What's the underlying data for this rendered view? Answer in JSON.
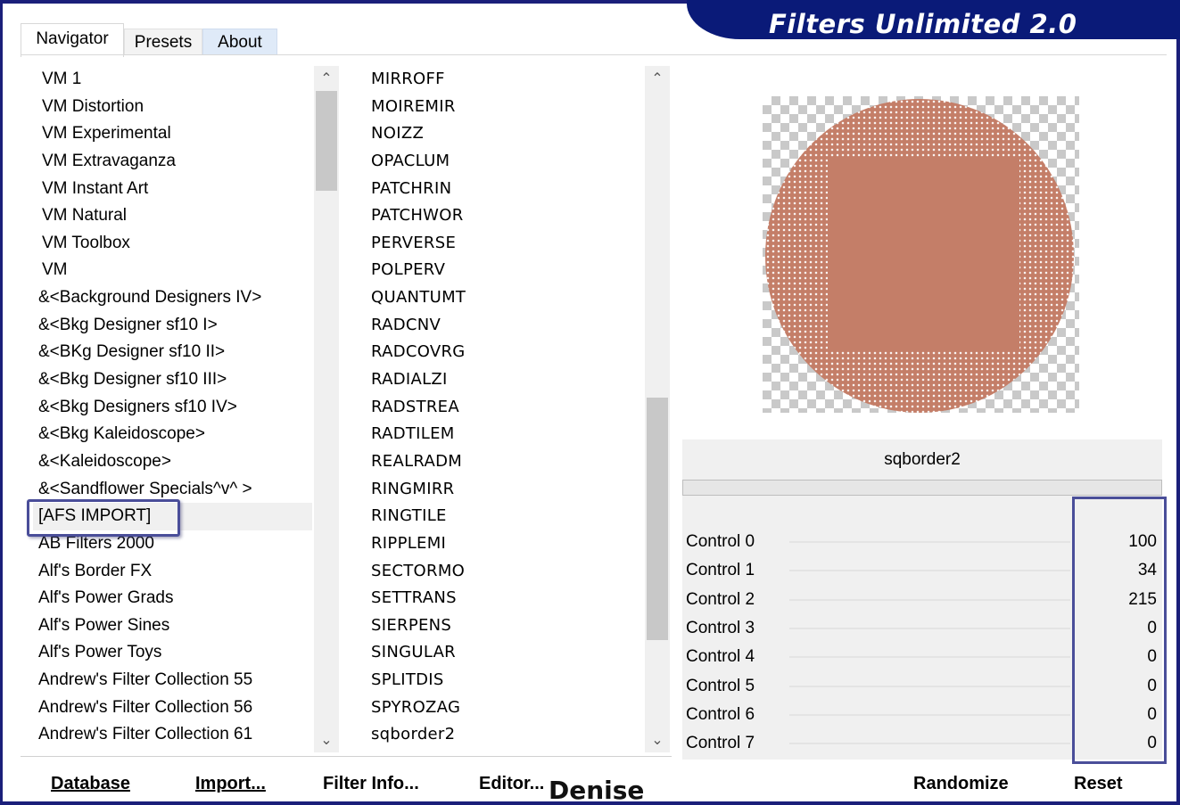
{
  "banner": {
    "title": "Filters Unlimited 2.0"
  },
  "tabs": {
    "navigator": "Navigator",
    "presets": "Presets",
    "about": "About"
  },
  "categories": [
    "VM 1",
    "VM Distortion",
    "VM Experimental",
    "VM Extravaganza",
    "VM Instant Art",
    "VM Natural",
    "VM Toolbox",
    "VM",
    "&<Background Designers IV>",
    "&<Bkg Designer sf10 I>",
    "&<BKg Designer sf10 II>",
    "&<Bkg Designer sf10 III>",
    "&<Bkg Designers sf10 IV>",
    "&<Bkg Kaleidoscope>",
    "&<Kaleidoscope>",
    "&<Sandflower Specials^v^ >",
    "[AFS IMPORT]",
    "AB Filters 2000",
    "Alf's Border FX",
    "Alf's Power Grads",
    "Alf's Power Sines",
    "Alf's Power Toys",
    "Andrew's Filter Collection 55",
    "Andrew's Filter Collection 56",
    "Andrew's Filter Collection 61"
  ],
  "filters": [
    "MIRROFF",
    "MOIREMIR",
    "NOIZZ",
    "OPACLUM",
    "PATCHRIN",
    "PATCHWOR",
    "PERVERSE",
    "POLPERV",
    "QUANTUMT",
    "RADCNV",
    "RADCOVRG",
    "RADIALZI",
    "RADSTREA",
    "RADTILEM",
    "REALRADM",
    "RINGMIRR",
    "RINGTILE",
    "RIPPLEMI",
    "SECTORMO",
    "SETTRANS",
    "SIERPENS",
    "SINGULAR",
    "SPLITDIS",
    "SPYROZAG",
    "sqborder2"
  ],
  "selected_filter_name": "sqborder2",
  "controls": [
    {
      "label": "Control 0",
      "value": "100"
    },
    {
      "label": "Control 1",
      "value": "34"
    },
    {
      "label": "Control 2",
      "value": "215"
    },
    {
      "label": "Control 3",
      "value": "0"
    },
    {
      "label": "Control 4",
      "value": "0"
    },
    {
      "label": "Control 5",
      "value": "0"
    },
    {
      "label": "Control 6",
      "value": "0"
    },
    {
      "label": "Control 7",
      "value": "0"
    }
  ],
  "buttons": {
    "database": "Database",
    "import": "Import...",
    "filter_info": "Filter Info...",
    "editor": "Editor...",
    "randomize": "Randomize",
    "reset": "Reset"
  },
  "signature": "Denise",
  "icons": {
    "scroll_up": "chevron-up-icon",
    "scroll_down": "chevron-down-icon"
  },
  "colors": {
    "banner": "#0a1a78",
    "preview_fill": "#c47e68",
    "highlight": "#4a4e99"
  }
}
